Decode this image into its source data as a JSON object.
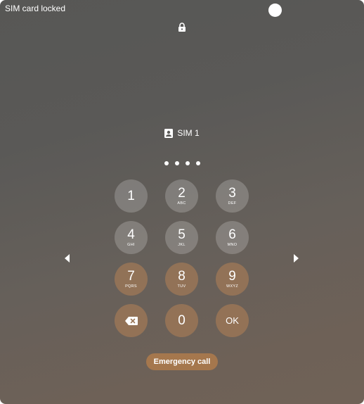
{
  "status_bar": {
    "sim_status": "SIM card locked"
  },
  "sim": {
    "label": "SIM 1",
    "icon": "sim-contact-icon"
  },
  "pin": {
    "entered_count": 4
  },
  "keypad": {
    "keys": [
      {
        "digit": "1",
        "letters": ""
      },
      {
        "digit": "2",
        "letters": "ABC"
      },
      {
        "digit": "3",
        "letters": "DEF"
      },
      {
        "digit": "4",
        "letters": "GHI"
      },
      {
        "digit": "5",
        "letters": "JKL"
      },
      {
        "digit": "6",
        "letters": "MNO"
      },
      {
        "digit": "7",
        "letters": "PQRS"
      },
      {
        "digit": "8",
        "letters": "TUV"
      },
      {
        "digit": "9",
        "letters": "WXYZ"
      }
    ],
    "zero": "0",
    "ok_label": "OK",
    "backspace_icon": "backspace-icon"
  },
  "emergency_label": "Emergency call",
  "colors": {
    "key_accent": "#b4825a",
    "emergency_button": "#a5774d"
  }
}
